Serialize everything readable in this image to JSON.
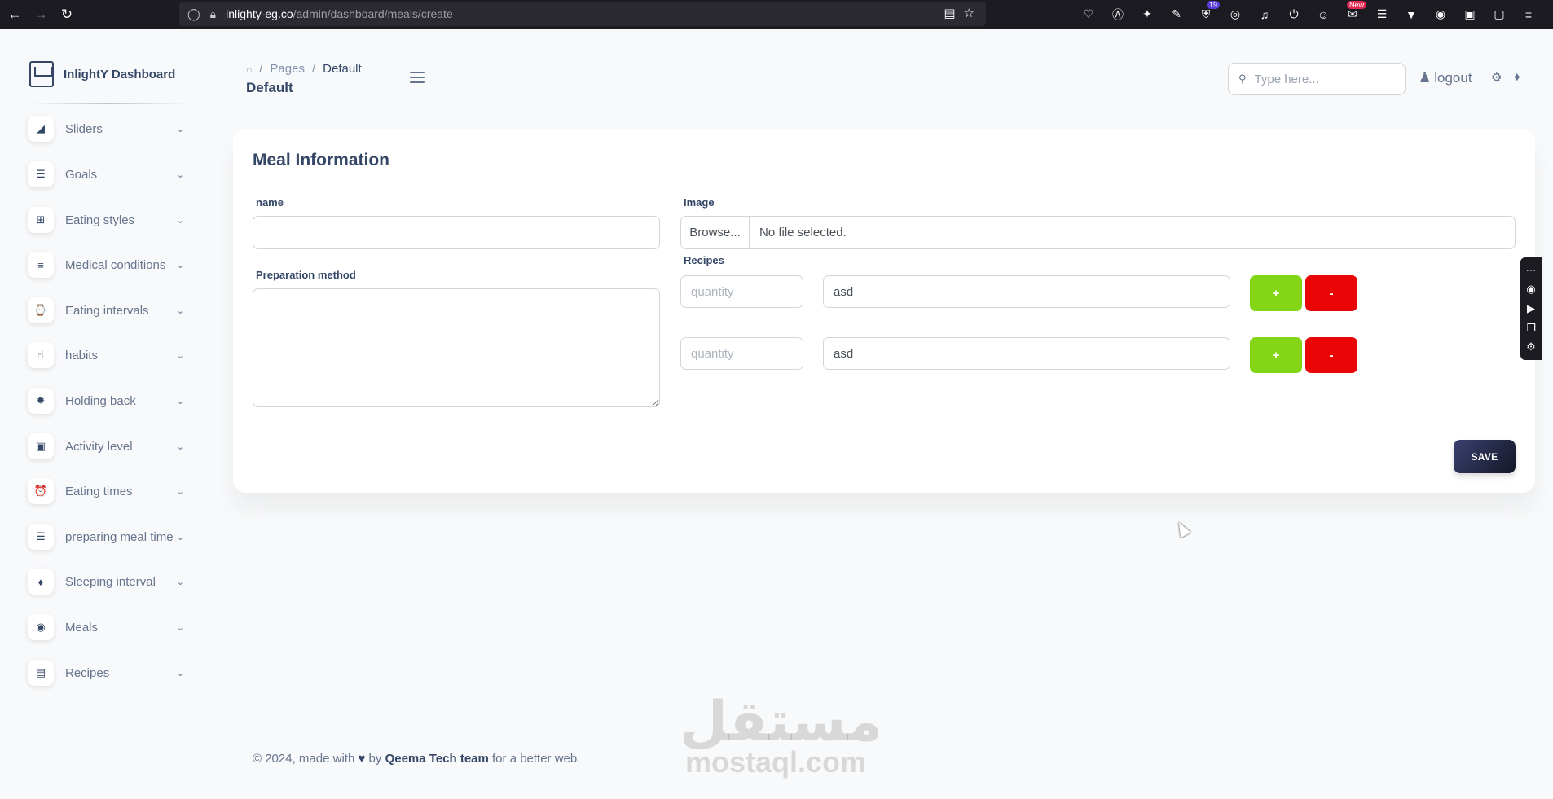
{
  "browser": {
    "url_host": "inlighty-eg.co",
    "url_path": "/admin/dashboard/meals/create",
    "extension_badge_count": "19",
    "extension_badge_new": "New"
  },
  "brand": {
    "name": "InlightY Dashboard"
  },
  "sidebar": {
    "items": [
      {
        "label": "Sliders",
        "icon": "cube-icon"
      },
      {
        "label": "Goals",
        "icon": "list-icon"
      },
      {
        "label": "Eating styles",
        "icon": "grid-icon"
      },
      {
        "label": "Medical conditions",
        "icon": "align-icon"
      },
      {
        "label": "Eating intervals",
        "icon": "watch-icon"
      },
      {
        "label": "habits",
        "icon": "pointer-hand-icon"
      },
      {
        "label": "Holding back",
        "icon": "life-ring-icon"
      },
      {
        "label": "Activity level",
        "icon": "suitcase-icon"
      },
      {
        "label": "Eating times",
        "icon": "alarm-clock-icon"
      },
      {
        "label": "preparing meal time",
        "icon": "list-icon"
      },
      {
        "label": "Sleeping interval",
        "icon": "bell-icon"
      },
      {
        "label": "Meals",
        "icon": "utensils-icon"
      },
      {
        "label": "Recipes",
        "icon": "receipt-icon"
      }
    ]
  },
  "header": {
    "breadcrumb": {
      "parent": "Pages",
      "current": "Default"
    },
    "title": "Default",
    "search_placeholder": "Type here...",
    "logout_label": "logout"
  },
  "form": {
    "title": "Meal Information",
    "name_label": "name",
    "name_value": "",
    "preparation_label": "Preparation method",
    "preparation_value": "",
    "image_label": "Image",
    "browse_label": "Browse...",
    "file_status": "No file selected.",
    "recipes_label": "Recipes",
    "recipes": [
      {
        "quantity_placeholder": "quantity",
        "name": "asd"
      },
      {
        "quantity_placeholder": "quantity",
        "name": "asd"
      }
    ],
    "plus_label": "+",
    "minus_label": "-",
    "save_label": "SAVE"
  },
  "footer": {
    "prefix": "© 2024, made with",
    "by": "by",
    "team": "Qeema Tech team",
    "suffix": "for a better web."
  },
  "watermark": {
    "arabic": "مستقل",
    "latin": "mostaql.com"
  },
  "colors": {
    "plus": "#82d616",
    "minus": "#ea0606",
    "save": "#141727",
    "text": "#344767"
  }
}
